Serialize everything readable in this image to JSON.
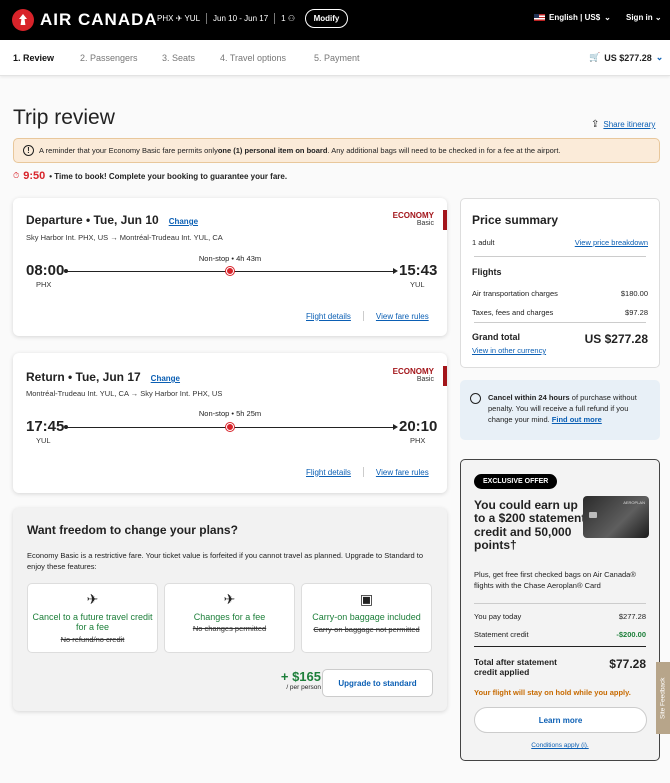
{
  "header": {
    "brand": "AIR CANADA",
    "route": "PHX ✈ YUL",
    "dates": "Jun 10 - Jun 17",
    "pax": "1 ⚇",
    "modify": "Modify",
    "language": "English | US$",
    "sign_in": "Sign in"
  },
  "steps": [
    "1. Review",
    "2. Passengers",
    "3. Seats",
    "4. Travel options",
    "5. Payment"
  ],
  "cart_total": "US $277.28",
  "page_title": "Trip review",
  "share": "Share itinerary",
  "notice": {
    "pre": "A reminder that your Economy Basic fare permits only ",
    "bold": "one (1) personal item on board",
    "post": ". Any additional bags will need to be checked in for a fee at the airport."
  },
  "timer": {
    "time": "9:50",
    "text": "• Time to book! Complete your booking to guarantee your fare."
  },
  "departure": {
    "title": "Departure • Tue, Jun 10",
    "change": "Change",
    "route": "Sky Harbor Int. PHX, US → Montréal-Trudeau Int. YUL, CA",
    "cabin": "ECONOMY",
    "fare": "Basic",
    "nonstop": "Non-stop • 4h 43m",
    "dep_time": "08:00",
    "dep_apt": "PHX",
    "arr_time": "15:43",
    "arr_apt": "YUL",
    "details": "Flight details",
    "fare_rules": "View fare rules"
  },
  "return": {
    "title": "Return • Tue, Jun 17",
    "change": "Change",
    "route": "Montréal-Trudeau Int. YUL, CA → Sky Harbor Int. PHX, US",
    "cabin": "ECONOMY",
    "fare": "Basic",
    "nonstop": "Non-stop • 5h 25m",
    "dep_time": "17:45",
    "dep_apt": "YUL",
    "arr_time": "20:10",
    "arr_apt": "PHX",
    "details": "Flight details",
    "fare_rules": "View fare rules"
  },
  "upsell": {
    "title": "Want freedom to change your plans?",
    "text": "Economy Basic is a restrictive fare. Your ticket value is forfeited if you cannot travel as planned. Upgrade to Standard to enjoy these features:",
    "features": [
      {
        "icon": "✈",
        "label": "Cancel to a future travel credit for a fee",
        "strike": "No refund/no credit"
      },
      {
        "icon": "✈",
        "label": "Changes for a fee",
        "strike": "No changes permitted"
      },
      {
        "icon": "▣",
        "label": "Carry-on baggage included",
        "strike": "Carry-on baggage not permitted"
      }
    ],
    "price": "+ $165",
    "per": "/ per person",
    "button": "Upgrade to standard"
  },
  "summary": {
    "title": "Price summary",
    "adults": "1 adult",
    "breakdown": "View price breakdown",
    "flights": "Flights",
    "air_label": "Air transportation charges",
    "air_value": "$180.00",
    "tax_label": "Taxes, fees and charges",
    "tax_value": "$97.28",
    "total_label": "Grand total",
    "total_value": "US $277.28",
    "currency": "View in other currency"
  },
  "cancel_box": {
    "bold": "Cancel within 24 hours",
    "text": " of purchase without penalty. You will receive a full refund if you change your mind. ",
    "link": "Find out more"
  },
  "offer": {
    "badge": "EXCLUSIVE OFFER",
    "headline": "You could earn up to a $200 statement credit and 50,000 points†",
    "card_name": "AEROPLAN",
    "text": "Plus, get free first checked bags on Air Canada® flights with the Chase Aeroplan® Card",
    "pay_label": "You pay today",
    "pay_value": "$277.28",
    "credit_label": "Statement credit",
    "credit_value": "-$200.00",
    "after_label": "Total after statement credit applied",
    "after_value": "$77.28",
    "hold": "Your flight will stay on hold while you apply.",
    "learn": "Learn more",
    "conditions": "Conditions apply (i)."
  },
  "feedback": "Site Feedback",
  "colors": {
    "brand_red": "#d8232a",
    "link": "#0b5fb4",
    "green": "#1d7f3a",
    "cabin": "#a3151a"
  }
}
